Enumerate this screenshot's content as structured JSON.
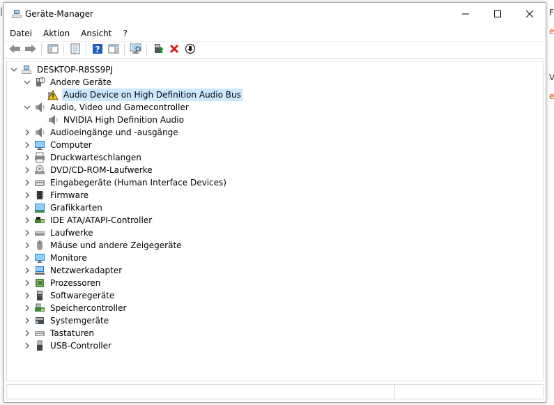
{
  "window": {
    "title": "Geräte-Manager",
    "minimize_glyph": "—",
    "maximize_glyph": "☐",
    "close_glyph": "✕"
  },
  "background": {
    "fragments": [
      "F",
      "e",
      "V",
      "e"
    ]
  },
  "menu": {
    "items": [
      "Datei",
      "Aktion",
      "Ansicht",
      "?"
    ]
  },
  "toolbar": {
    "buttons": [
      "back-icon",
      "forward-icon",
      "show-hide-console-tree-icon",
      "properties-icon",
      "help-icon",
      "action-pane-icon",
      "scan-hardware-icon",
      "update-driver-icon",
      "uninstall-device-icon",
      "disable-device-icon"
    ]
  },
  "tree": {
    "computer": "DESKTOP-R8SS9PJ",
    "other_devices": "Andere Geräte",
    "other_devices_child": "Audio Device on High Definition Audio Bus",
    "audio_video": "Audio, Video und Gamecontroller",
    "audio_video_child": "NVIDIA High Definition Audio",
    "categories": [
      "Audioeingänge und -ausgänge",
      "Computer",
      "Druckwarteschlangen",
      "DVD/CD-ROM-Laufwerke",
      "Eingabegeräte (Human Interface Devices)",
      "Firmware",
      "Grafikkarten",
      "IDE ATA/ATAPI-Controller",
      "Laufwerke",
      "Mäuse und andere Zeigegeräte",
      "Monitore",
      "Netzwerkadapter",
      "Prozessoren",
      "Softwaregeräte",
      "Speichercontroller",
      "Systemgeräte",
      "Tastaturen",
      "USB-Controller"
    ],
    "category_icons": [
      "speaker-icon",
      "monitor-icon",
      "printer-icon",
      "disc-drive-icon",
      "hid-icon",
      "chip-icon",
      "display-adapter-icon",
      "ide-controller-icon",
      "drive-icon",
      "mouse-icon",
      "monitor-icon",
      "network-icon",
      "processor-icon",
      "software-device-icon",
      "storage-controller-icon",
      "system-device-icon",
      "keyboard-icon",
      "usb-icon"
    ],
    "expander_collapsed": "›",
    "expander_expanded": "⌄"
  },
  "colors": {
    "selection": "#cce8ff",
    "warning": "#f5c400",
    "uninstall_red": "#d41a1a",
    "update_green": "#1e8a2e",
    "help_blue": "#1f5fbf"
  }
}
